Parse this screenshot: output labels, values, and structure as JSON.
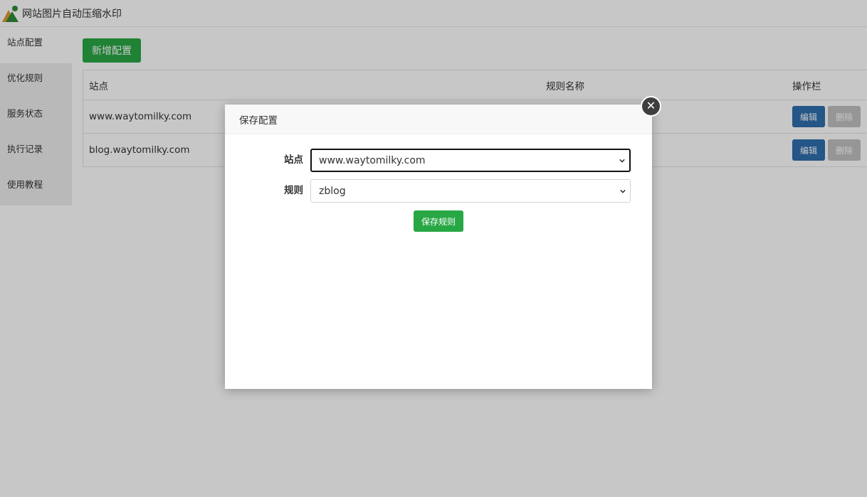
{
  "header": {
    "title": "网站图片自动压缩水印",
    "logo_icon": "mountain-logo-icon"
  },
  "sidebar": {
    "items": [
      {
        "label": "站点配置",
        "active": true
      },
      {
        "label": "优化规则"
      },
      {
        "label": "服务状态"
      },
      {
        "label": "执行记录"
      },
      {
        "label": "使用教程"
      }
    ]
  },
  "main": {
    "add_button_label": "新增配置",
    "table": {
      "columns": [
        "站点",
        "规则名称",
        "操作栏"
      ],
      "rows": [
        {
          "site": "www.waytomilky.com",
          "rule": "",
          "edit_label": "编辑",
          "delete_label": "删除"
        },
        {
          "site": "blog.waytomilky.com",
          "rule": "",
          "edit_label": "编辑",
          "delete_label": "删除"
        }
      ]
    }
  },
  "dialog": {
    "title": "保存配置",
    "close_icon": "close-icon",
    "site_label": "站点",
    "site_value": "www.waytomilky.com",
    "rule_label": "规则",
    "rule_value": "zblog",
    "save_button_label": "保存规则"
  },
  "colors": {
    "primary_green": "#28a745",
    "edit_blue": "#2f6fae",
    "delete_gray": "#c0c0c0",
    "overlay": "rgba(0,0,0,0.22)"
  }
}
